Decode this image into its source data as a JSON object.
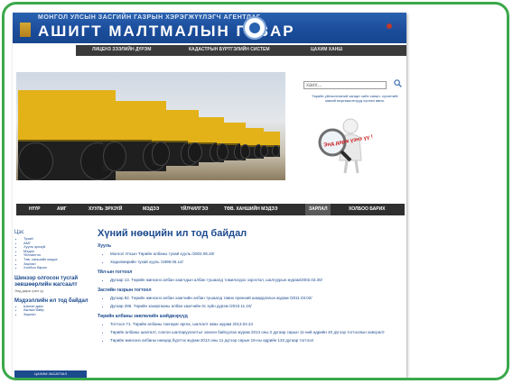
{
  "header": {
    "agency": "МОНГОЛ УЛСЫН ЗАСГИЙН ГАЗРЫН ХЭРЭГЖҮҮЛЭГЧ АГЕНТЛАГ",
    "title": "АШИГТ МАЛТМАЛЫН ГАЗАР",
    "lang_flags": [
      "mn",
      "en"
    ],
    "colors": {
      "banner": "#1a4c9a",
      "frame": "#3aa84a"
    }
  },
  "top_nav": [
    "ЛИЦЕНЗ ЗЭЭЛИЙН ДҮРЭМ",
    "КАДАСТРЫН БҮРТГЭЛИЙН СИСТЕМ",
    "ЦАХИМ ХАНШ"
  ],
  "search": {
    "placeholder": "хайх..."
  },
  "side_promo": {
    "text": "Төрийн үйлчилгээний чанарт хийх санал, хүсэлтийг манай мэргэжилтнүүд хүлээн авна.",
    "ribbon": "Энд дарж үзнэ үү !"
  },
  "main_nav": [
    "НҮҮР",
    "АМГ",
    "ХУУЛЬ ЭРХЗҮЙ",
    "МЭДЭЭ",
    "ҮЙЛЧИЛГЭЭ",
    "ТӨВ. ХАНШИЙН МЭДЭЭ",
    "ЗАРЛАЛ",
    "ХОЛБОО БАРИХ"
  ],
  "main_nav_active": "ЗАРЛАЛ",
  "sidebar": {
    "heading": "Цэс",
    "items": [
      "Тухай",
      "АМГ",
      "Хууль эрхзүй",
      "Мэдээ",
      "Үйлчилгээ",
      "Төв. ханшийн мэдээ",
      "Зарлал",
      "Холбоо барих"
    ],
    "section2_title": "Шинээр олгосон тусгай зөвшөөрлийн жагсаалт",
    "section2_text": "Энд дарж үзнэ үү",
    "section3_title": "Мэдээллийн ил тод байдал",
    "section3_items": [
      "Шилэн данс",
      "Ажлын байр",
      "Зарлал"
    ],
    "bottom_button": "ЦАХИМ ЗАСАГЛАЛ"
  },
  "content": {
    "title": "Хүний нөөцийн ил тод байдал",
    "sections": [
      {
        "heading": "Хууль",
        "items": [
          "Монгол Улсын Төрийн албаны тухай хууль /2002.06.20/",
          "Хөдөлмөрийн тухай хууль /1999.05.14/"
        ]
      },
      {
        "heading": "Үйл-ын тогтоол",
        "items": [
          "Дугаар 13. Төрийн жинхэнэ албан хаагчдын албан тушаалд томилогдох зэрэглэл, шалгуурын журам/2002.03.30/"
        ]
      },
      {
        "heading": "Засгийн газрын тогтоол",
        "items": [
          "Дугаар 82. Төрийн жинхэнэ албан хаагчийн албан тушаалд тавих ерөнхий шаардлагын журам /2011.03.02/",
          "Дугаар 295. Төрийн захиргааны албан хаагчийн ёс зүйн дүрэм /2010.11.10/"
        ]
      },
      {
        "heading": "Төрийн албаны зөвлөлийн шийдвэрүүд",
        "items": [
          "Тогтоол 71. Төрийн албаны тангараг өргөх, шалгалт авах журам 2013.04.24",
          "Төрийн албаны шалгалт, сонгон шалгаруулалтыг зохион байгуулах журам 2013 оны 2 дугаар сарын 11-ний өдрийн 40 дүгээр тогтоолын хавсралт",
          "Төрийн жинхэнэ албаны нөөцөд бүртгэх журам 2013 оны 11 дүгээр сарын 19-ны өдрийн 133 дугаар тогтоол"
        ]
      }
    ]
  }
}
